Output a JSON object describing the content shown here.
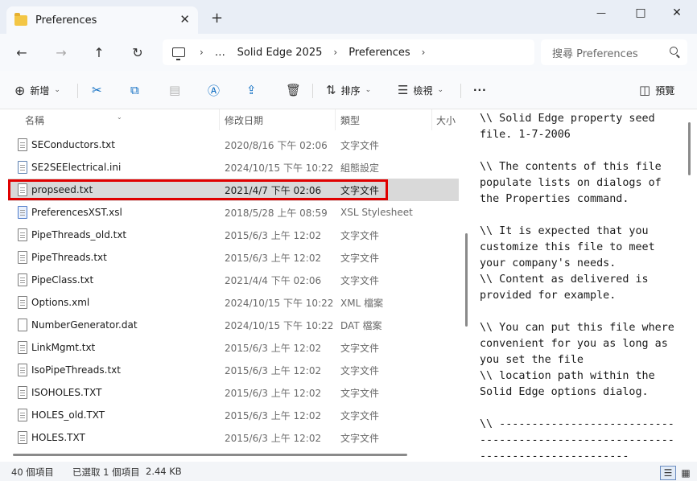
{
  "window": {
    "tab_title": "Preferences",
    "new_tab": "+",
    "close_tab": "✕",
    "minimize": "—",
    "maximize": "□",
    "close": "✕"
  },
  "nav": {
    "back": "←",
    "forward": "→",
    "up": "↑",
    "refresh": "↻",
    "breadcrumb": [
      "…",
      "Solid Edge 2025",
      "Preferences"
    ],
    "separator": "›",
    "search_placeholder": "搜尋 Preferences"
  },
  "toolbar": {
    "new_label": "新增",
    "sort_label": "排序",
    "view_label": "檢視",
    "more_label": "···",
    "preview_label": "預覽"
  },
  "columns": {
    "name": "名稱",
    "date": "修改日期",
    "type": "類型",
    "size": "大小"
  },
  "files": [
    {
      "name": "SEConductors.txt",
      "date": "2020/8/16 下午 02:06",
      "type": "文字文件",
      "icon": "text-file-icon"
    },
    {
      "name": "SE2SEElectrical.ini",
      "date": "2024/10/15 下午 10:22",
      "type": "組態設定",
      "icon": "ini-file-icon"
    },
    {
      "name": "propseed.txt",
      "date": "2021/4/7 下午 02:06",
      "type": "文字文件",
      "icon": "text-file-icon",
      "selected": true
    },
    {
      "name": "PreferencesXST.xsl",
      "date": "2018/5/28 上午 08:59",
      "type": "XSL Stylesheet",
      "icon": "xsl-file-icon"
    },
    {
      "name": "PipeThreads_old.txt",
      "date": "2015/6/3 上午 12:02",
      "type": "文字文件",
      "icon": "text-file-icon"
    },
    {
      "name": "PipeThreads.txt",
      "date": "2015/6/3 上午 12:02",
      "type": "文字文件",
      "icon": "text-file-icon"
    },
    {
      "name": "PipeClass.txt",
      "date": "2021/4/4 下午 02:06",
      "type": "文字文件",
      "icon": "text-file-icon"
    },
    {
      "name": "Options.xml",
      "date": "2024/10/15 下午 10:22",
      "type": "XML 檔案",
      "icon": "xml-file-icon"
    },
    {
      "name": "NumberGenerator.dat",
      "date": "2024/10/15 下午 10:22",
      "type": "DAT 檔案",
      "icon": "blank-file-icon"
    },
    {
      "name": "LinkMgmt.txt",
      "date": "2015/6/3 上午 12:02",
      "type": "文字文件",
      "icon": "text-file-icon"
    },
    {
      "name": "IsoPipeThreads.txt",
      "date": "2015/6/3 上午 12:02",
      "type": "文字文件",
      "icon": "text-file-icon"
    },
    {
      "name": "ISOHOLES.TXT",
      "date": "2015/6/3 上午 12:02",
      "type": "文字文件",
      "icon": "text-file-icon"
    },
    {
      "name": "HOLES_old.TXT",
      "date": "2015/6/3 上午 12:02",
      "type": "文字文件",
      "icon": "text-file-icon"
    },
    {
      "name": "HOLES.TXT",
      "date": "2015/6/3 上午 12:02",
      "type": "文字文件",
      "icon": "text-file-icon"
    }
  ],
  "preview": {
    "lines": [
      "\\\\ Solid Edge property seed",
      "file. 1-7-2006",
      "",
      "\\\\ The contents of this file",
      "populate lists on dialogs of",
      "the Properties command.",
      "",
      "\\\\ It is expected that you",
      "customize this file to meet",
      "your company's needs.",
      "\\\\ Content as delivered is",
      "provided for example.",
      "",
      "\\\\ You can put this file where",
      "convenient for you as long as",
      "you set the file",
      "\\\\ location path within the",
      "Solid Edge options dialog.",
      "",
      "\\\\ ---------------------------",
      "------------------------------",
      "-----------------------"
    ]
  },
  "status": {
    "item_count": "40 個項目",
    "selection": "已選取 1 個項目",
    "size": "2.44 KB"
  },
  "colors": {
    "highlight": "#e00000",
    "selected_row": "#d9d9d9",
    "accent": "#0a6bc2"
  }
}
